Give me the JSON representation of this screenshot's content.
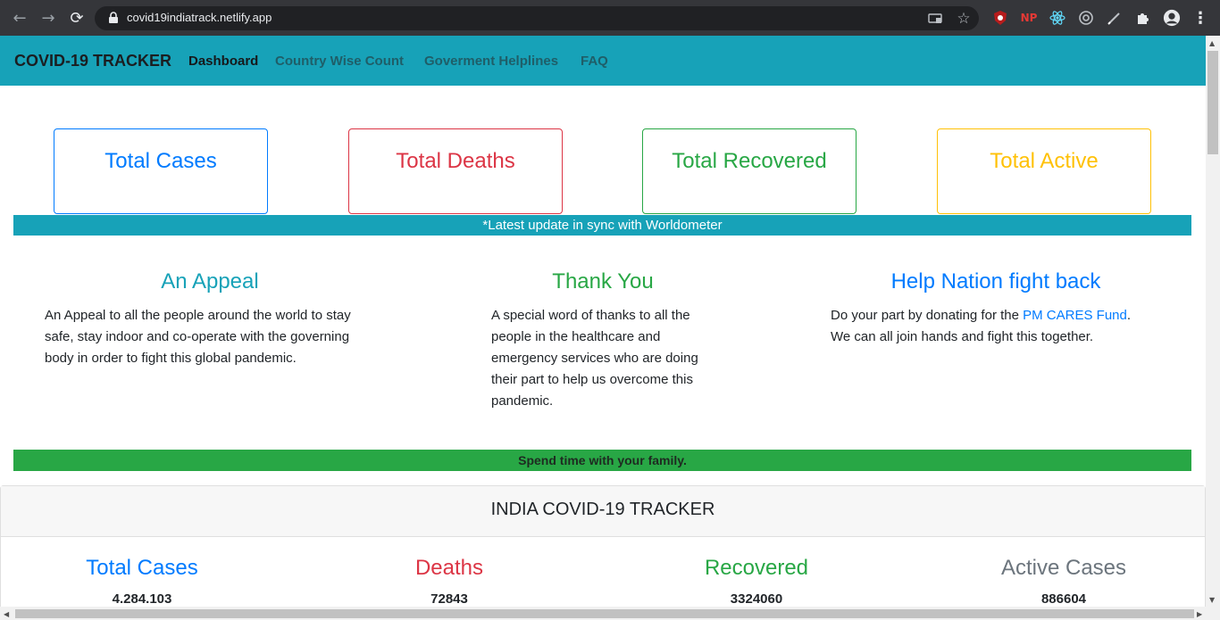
{
  "browser": {
    "url": "covid19indiatrack.netlify.app",
    "extensions": [
      "ublock-icon",
      "np-icon",
      "react-icon",
      "target-icon",
      "pen-icon",
      "puzzle-icon",
      "profile-icon"
    ],
    "np_label": "NP"
  },
  "navbar": {
    "brand": "COVID-19 TRACKER",
    "links": [
      "Dashboard",
      "Country Wise Count",
      "Goverment Helplines",
      "FAQ"
    ]
  },
  "stats": {
    "total_cases": "Total Cases",
    "total_deaths": "Total Deaths",
    "total_recovered": "Total Recovered",
    "total_active": "Total Active"
  },
  "update_banner": "*Latest update in sync with Worldometer",
  "columns": {
    "appeal": {
      "title": "An Appeal",
      "text": "An Appeal to all the people around the world to stay safe, stay indoor and co-operate with the governing body in order to fight this global pandemic."
    },
    "thanks": {
      "title": "Thank You",
      "text": "A special word of thanks to all the people in the healthcare and emergency services who are doing their part to help us overcome this pandemic."
    },
    "help": {
      "title": "Help Nation fight back",
      "text_before": "Do your part by donating for the ",
      "link": "PM CARES Fund",
      "text_after": ". We can all join hands and fight this together."
    }
  },
  "family_banner": "Spend time with your family.",
  "tracker": {
    "title": "INDIA COVID-19 TRACKER",
    "items": [
      {
        "label": "Total Cases",
        "value": "4.284.103",
        "color": "#007bff"
      },
      {
        "label": "Deaths",
        "value": "72843",
        "color": "#dc3545"
      },
      {
        "label": "Recovered",
        "value": "3324060",
        "color": "#28a745"
      },
      {
        "label": "Active Cases",
        "value": "886604",
        "color": "#6c757d"
      }
    ]
  },
  "colors": {
    "navbar": "#17a2b8",
    "blue": "#007bff",
    "red": "#dc3545",
    "green": "#28a745",
    "yellow": "#ffc107",
    "teal": "#17a2b8"
  }
}
